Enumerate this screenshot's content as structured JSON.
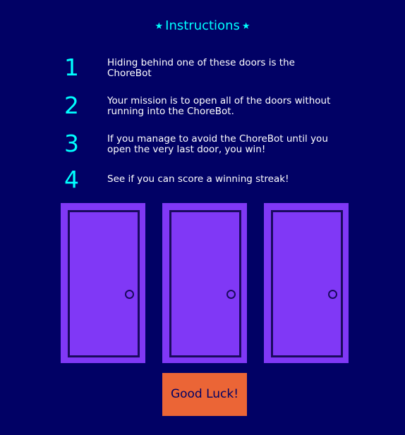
{
  "header": {
    "title": "Instructions",
    "star_left": "★",
    "star_right": "★"
  },
  "instructions": [
    {
      "number": "1",
      "text": "Hiding behind one of these doors is the ChoreBot"
    },
    {
      "number": "2",
      "text": "Your mission is to open all of the doors without running into the ChoreBot."
    },
    {
      "number": "3",
      "text": "If you manage to avoid the ChoreBot until you open the very last door, you win!"
    },
    {
      "number": "4",
      "text": "See if you can score a winning streak!"
    }
  ],
  "doors": [
    {
      "state": "closed"
    },
    {
      "state": "closed"
    },
    {
      "state": "closed"
    }
  ],
  "start_button": {
    "label": "Good Luck!"
  },
  "colors": {
    "background": "#010165",
    "accent": "#00ffff",
    "door": "#8038f6",
    "door_outline": "#1a0a5e",
    "button": "#eb6536"
  }
}
